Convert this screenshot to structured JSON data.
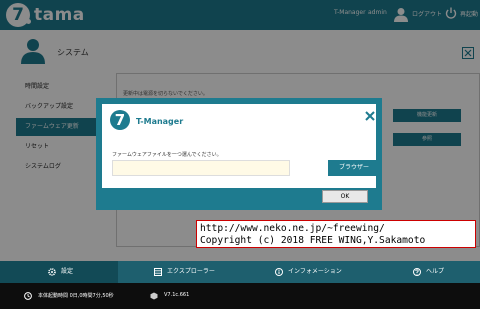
{
  "brand": {
    "logo_letter": "7",
    "name": "tama"
  },
  "topbar": {
    "app_name": "T-Manager",
    "user": "admin",
    "logout": "ログアウト",
    "reboot": "再起動"
  },
  "page": {
    "title": "システム"
  },
  "sidebar": {
    "items": [
      {
        "label": "時間設定"
      },
      {
        "label": "バックアップ設定"
      },
      {
        "label": "ファームウェア更新"
      },
      {
        "label": "リセット"
      },
      {
        "label": "システムログ"
      }
    ]
  },
  "content": {
    "note": "更新中は電源を切らないでください。",
    "buttons": [
      "機能更新",
      "参照"
    ]
  },
  "modal": {
    "logo_letter": "7",
    "title": "T-Manager",
    "message": "ファームウェアファイルを一つ選んでください。",
    "file_value": "",
    "browse_label": "ブラウザー",
    "ok_label": "OK"
  },
  "watermark": {
    "line1": "http://www.neko.ne.jp/~freewing/",
    "line2": "Copyright (c) 2018 FREE WING,Y.Sakamoto"
  },
  "bottom_nav": {
    "tabs": [
      {
        "label": "設定",
        "icon": "gear-icon"
      },
      {
        "label": "エクスプローラー",
        "icon": "explorer-icon"
      },
      {
        "label": "インフォメーション",
        "icon": "info-icon"
      },
      {
        "label": "ヘルプ",
        "icon": "help-icon"
      }
    ]
  },
  "status": {
    "uptime": "本体起動時間  0日,0時間7分,50秒",
    "version": "V7.1c.661"
  },
  "colors": {
    "accent": "#1e7b8f",
    "nav": "#1e5f6e",
    "status_bg": "#0d0d0d",
    "watermark_border": "#cc0000"
  }
}
